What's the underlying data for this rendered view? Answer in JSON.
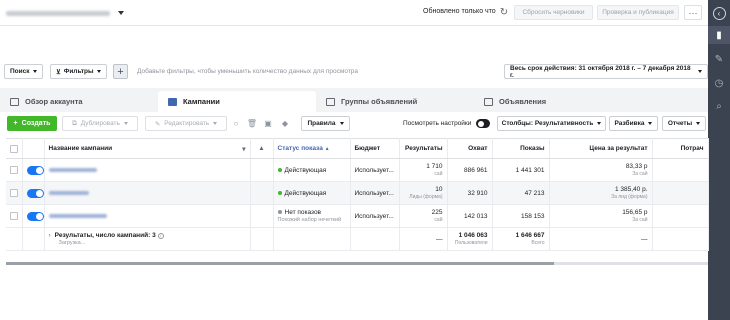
{
  "topbar": {
    "updated_text": "Обновлено только что",
    "discard_label": "Сбросить черновики",
    "review_label": "Проверка и публикация",
    "more_label": "···"
  },
  "filterbar": {
    "search_label": "Поиск",
    "filters_label": "Фильтры",
    "add_label": "+",
    "hint": "Добавьте фильтры, чтобы уменьшить количество данных для просмотра",
    "date_range": "Весь срок действия: 31 октября 2018 г. – 7 декабря 2018 г."
  },
  "tabs": [
    {
      "label": "Обзор аккаунта"
    },
    {
      "label": "Кампании"
    },
    {
      "label": "Группы объявлений"
    },
    {
      "label": "Объявления"
    }
  ],
  "toolbar": {
    "create_label": "Создать",
    "duplicate_label": "Дублировать",
    "edit_label": "Редактировать",
    "rules_label": "Правила",
    "view_settings_label": "Посмотреть настройки",
    "columns_label": "Столбцы: Результативность",
    "breakdown_label": "Разбивка",
    "reports_label": "Отчеты"
  },
  "table": {
    "headers": {
      "name": "Название кампании",
      "status": "Статус показа",
      "budget": "Бюджет",
      "results": "Результаты",
      "reach": "Охват",
      "impressions": "Показы",
      "cost": "Цена за результат",
      "spent": "Потрач"
    },
    "rows": [
      {
        "status": "Действующая",
        "status_sub": "",
        "budget": "Использует...",
        "results": "1 710",
        "results_sub": "сай",
        "reach": "886 961",
        "impressions": "1 441 301",
        "cost": "83,33 р",
        "cost_sub": "За сай"
      },
      {
        "status": "Действующая",
        "status_sub": "",
        "budget": "Использует...",
        "results": "10",
        "results_sub": "Лиды (форма)",
        "reach": "32 910",
        "impressions": "47 213",
        "cost": "1 385,40 р.",
        "cost_sub": "За лид (форма)"
      },
      {
        "status": "Нет показов",
        "status_sub": "Похожий набор нечеткий",
        "budget": "Использует...",
        "results": "225",
        "results_sub": "сай",
        "reach": "142 013",
        "impressions": "158 153",
        "cost": "156,65 р",
        "cost_sub": "За сай"
      }
    ],
    "total": {
      "label": "Результаты, число кампаний: 3",
      "sub": "Загрузка...",
      "results": "—",
      "reach": "1 046 063",
      "reach_sub": "Пользователи",
      "impressions": "1 646 667",
      "impressions_sub": "Всего",
      "cost": "—"
    }
  },
  "colors": {
    "status_active": "#42b72a",
    "status_inactive": "#8d949e",
    "accent": "#1877f2",
    "create": "#42b72a"
  }
}
